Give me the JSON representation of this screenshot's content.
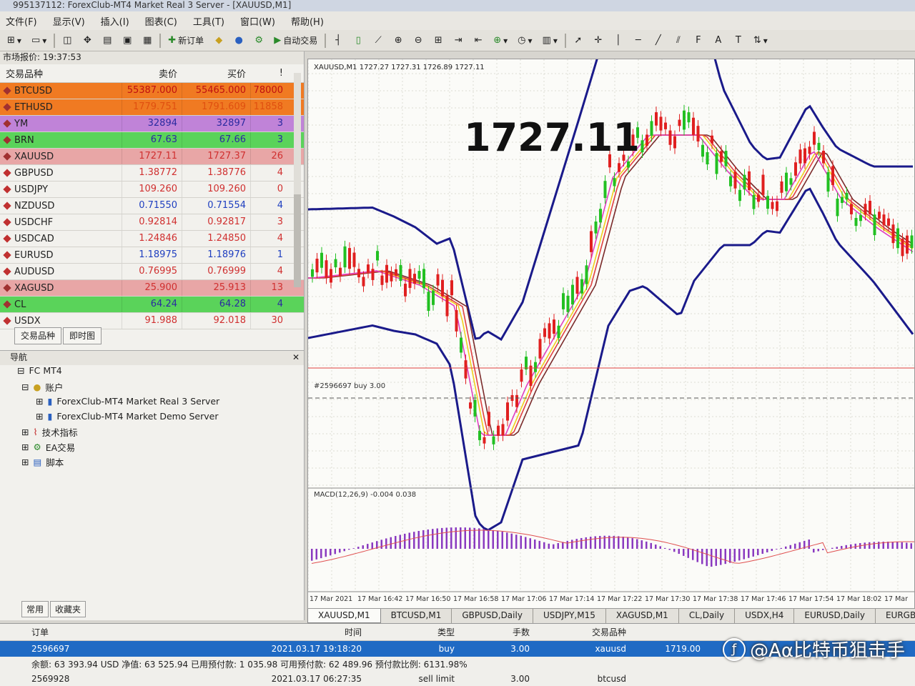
{
  "window": {
    "title": "995137112: ForexClub-MT4 Market Real 3 Server - [XAUUSD,M1]"
  },
  "menu": [
    "文件(F)",
    "显示(V)",
    "插入(I)",
    "图表(C)",
    "工具(T)",
    "窗口(W)",
    "帮助(H)"
  ],
  "toolbar": {
    "new_order": "新订单",
    "auto_trading": "自动交易"
  },
  "market_watch": {
    "title": "市场报价: 19:37:53",
    "headers": {
      "symbol": "交易品种",
      "bid": "卖价",
      "ask": "买价",
      "spread": "!"
    },
    "rows": [
      {
        "symbol": "BTCUSD",
        "bid": "55387.000",
        "ask": "55465.000",
        "spread": "78000",
        "bg": "#f07a22",
        "fg": "#c01010"
      },
      {
        "symbol": "ETHUSD",
        "bid": "1779.751",
        "ask": "1791.609",
        "spread": "11858",
        "bg": "#f07a22",
        "fg": "#e05010"
      },
      {
        "symbol": "YM",
        "bid": "32894",
        "ask": "32897",
        "spread": "3",
        "bg": "#c083d8",
        "fg": "#2a2aa0"
      },
      {
        "symbol": "BRN",
        "bid": "67.63",
        "ask": "67.66",
        "spread": "3",
        "bg": "#5ad35a",
        "fg": "#2a2aa0"
      },
      {
        "symbol": "XAUUSD",
        "bid": "1727.11",
        "ask": "1727.37",
        "spread": "26",
        "bg": "#e8a6a6",
        "fg": "#d03030"
      },
      {
        "symbol": "GBPUSD",
        "bid": "1.38772",
        "ask": "1.38776",
        "spread": "4",
        "bg": "#f2f1ed",
        "fg": "#d03030"
      },
      {
        "symbol": "USDJPY",
        "bid": "109.260",
        "ask": "109.260",
        "spread": "0",
        "bg": "#f2f1ed",
        "fg": "#d03030"
      },
      {
        "symbol": "NZDUSD",
        "bid": "0.71550",
        "ask": "0.71554",
        "spread": "4",
        "bg": "#f2f1ed",
        "fg": "#1f3fc0"
      },
      {
        "symbol": "USDCHF",
        "bid": "0.92814",
        "ask": "0.92817",
        "spread": "3",
        "bg": "#f2f1ed",
        "fg": "#d03030"
      },
      {
        "symbol": "USDCAD",
        "bid": "1.24846",
        "ask": "1.24850",
        "spread": "4",
        "bg": "#f2f1ed",
        "fg": "#d03030"
      },
      {
        "symbol": "EURUSD",
        "bid": "1.18975",
        "ask": "1.18976",
        "spread": "1",
        "bg": "#f2f1ed",
        "fg": "#1f3fc0"
      },
      {
        "symbol": "AUDUSD",
        "bid": "0.76995",
        "ask": "0.76999",
        "spread": "4",
        "bg": "#f2f1ed",
        "fg": "#d03030"
      },
      {
        "symbol": "XAGUSD",
        "bid": "25.900",
        "ask": "25.913",
        "spread": "13",
        "bg": "#e8a6a6",
        "fg": "#d03030"
      },
      {
        "symbol": "CL",
        "bid": "64.24",
        "ask": "64.28",
        "spread": "4",
        "bg": "#5ad35a",
        "fg": "#2a2aa0"
      },
      {
        "symbol": "USDX",
        "bid": "91.988",
        "ask": "92.018",
        "spread": "30",
        "bg": "#f2f1ed",
        "fg": "#d03030"
      }
    ],
    "tabs": [
      "交易品种",
      "即时图"
    ]
  },
  "navigator": {
    "title": "导航",
    "root": "FC MT4",
    "accounts": "账户",
    "server_real": "ForexClub-MT4 Market Real 3 Server",
    "server_demo": "ForexClub-MT4 Market Demo Server",
    "indicators": "技术指标",
    "ea": "EA交易",
    "scripts": "脚本",
    "tabs": [
      "常用",
      "收藏夹"
    ]
  },
  "chart": {
    "header": "XAUUSD,M1  1727.27 1727.31 1726.89 1727.11",
    "big_price": "1727.11",
    "order_label": "#2596697 buy 3.00",
    "macd_label": "MACD(12,26,9) -0.004 0.038",
    "time_labels": [
      "17 Mar 2021",
      "17 Mar 16:42",
      "17 Mar 16:50",
      "17 Mar 16:58",
      "17 Mar 17:06",
      "17 Mar 17:14",
      "17 Mar 17:22",
      "17 Mar 17:30",
      "17 Mar 17:38",
      "17 Mar 17:46",
      "17 Mar 17:54",
      "17 Mar 18:02",
      "17 Mar"
    ],
    "colors": {
      "bull": "#22c022",
      "bear": "#e02020",
      "bollinger": "#1a1a8a",
      "ma_yellow": "#f0d020",
      "ma_red": "#e04040",
      "ma_brown": "#7a2a2a",
      "ma_pink": "#e040c0",
      "macd_hist": "#8a3ac0",
      "macd_signal": "#e05050"
    }
  },
  "chart_tabs": [
    "XAUUSD,M1",
    "BTCUSD,M1",
    "GBPUSD,Daily",
    "USDJPY,M15",
    "XAGUSD,M1",
    "CL,Daily",
    "USDX,H4",
    "EURUSD,Daily",
    "EURGBP,"
  ],
  "terminal": {
    "headers": {
      "order": "订单",
      "time": "时间",
      "type": "类型",
      "lots": "手数",
      "symbol": "交易品种"
    },
    "rows": [
      {
        "order": "2596697",
        "time": "2021.03.17 19:18:20",
        "type": "buy",
        "lots": "3.00",
        "symbol": "xauusd",
        "price": "1719.00"
      },
      {
        "order": "2569928",
        "time": "2021.03.17 06:27:35",
        "type": "sell limit",
        "lots": "3.00",
        "symbol": "btcusd",
        "price": ""
      }
    ],
    "balance": "余额: 63 393.94 USD  净值: 63 525.94  已用预付款: 1 035.98  可用预付款: 62 489.96  预付款比例: 6131.98%"
  },
  "watermark": "@Aα比特币狙击手"
}
